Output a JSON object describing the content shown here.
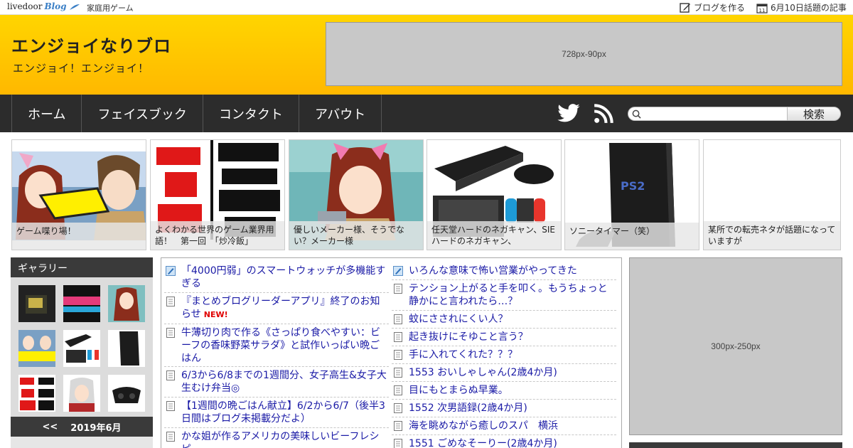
{
  "topbar": {
    "logo_main": "livedoor",
    "logo_blog": "Blog",
    "category": "家庭用ゲーム",
    "create_blog": "ブログを作る",
    "topic": "6月10日話題の記事",
    "calendar_day": "11"
  },
  "header": {
    "title": "エンジョイなりブロ",
    "description": "エンジョイ！エンジョイ！",
    "ad_label": "728px-90px"
  },
  "nav": {
    "items": [
      "ホーム",
      "フェイスブック",
      "コンタクト",
      "アバウト"
    ],
    "search_placeholder": "",
    "search_label": "検索"
  },
  "featured": [
    {
      "caption": "ゲーム喋り場！"
    },
    {
      "caption": "よくわかる世界のゲーム業界用語！　第一回　「炒冷飯」"
    },
    {
      "caption": "優しいメーカー様、そうでない？メーカー様"
    },
    {
      "caption": "任天堂ハードのネガキャン、SIEハードのネガキャン、"
    },
    {
      "caption": "ソニータイマー（笑）"
    },
    {
      "caption": "某所での転売ネタが話題になっていますが"
    }
  ],
  "sidebar": {
    "gallery_title": "ギャラリー",
    "calendar_prev": "<<",
    "calendar_month": "2019年6月"
  },
  "articles_left": [
    {
      "title": "「4000円弱」のスマートウォッチが多機能すぎる",
      "icon": "pen-icon"
    },
    {
      "title": "『まとめブログリーダーアプリ』終了のお知らせ",
      "icon": "doc-icon",
      "badge": "NEW!"
    },
    {
      "title": "牛薄切り肉で作る《さっぱり食べやすい：ビーフの香味野菜サラダ》と試作いっぱい晩ごはん",
      "icon": "doc-icon"
    },
    {
      "title": "6/3から6/8までの1週間分、女子高生&女子大生むけ弁当◎",
      "icon": "doc-icon"
    },
    {
      "title": "【1週間の晩ごはん献立】6/2から6/7（後半3日間はブログ未掲載分だよ）",
      "icon": "doc-icon"
    },
    {
      "title": "かな姐が作るアメリカの美味しいビーフレシピ",
      "icon": "doc-icon"
    }
  ],
  "articles_right": [
    {
      "title": "いろんな意味で怖い営業がやってきた",
      "icon": "pen-icon"
    },
    {
      "title": "テンション上がると手を叩く。もうちょっと静かにと言われたら…？",
      "icon": "doc-icon"
    },
    {
      "title": "蚊にさされにくい人？",
      "icon": "doc-icon"
    },
    {
      "title": "起き抜けにそゆこと言う？",
      "icon": "doc-icon"
    },
    {
      "title": "手に入れてくれた？？？",
      "icon": "doc-icon"
    },
    {
      "title": "1553 おいしゃしゃん(2歳4か月)",
      "icon": "doc-icon"
    },
    {
      "title": "目にもとまらぬ早業。",
      "icon": "doc-icon"
    },
    {
      "title": "1552 次男語録(2歳4か月)",
      "icon": "doc-icon"
    },
    {
      "title": "海を眺めながら癒しのスパ　横浜",
      "icon": "doc-icon"
    },
    {
      "title": "1551 ごめなそーりー(2歳4か月)",
      "icon": "doc-icon"
    }
  ],
  "right_ad": {
    "label": "300px-250px"
  },
  "colors": {
    "header": "#ffc800",
    "nav": "#2c2c2c",
    "link": "#1a1aa6",
    "new": "#e00000"
  }
}
